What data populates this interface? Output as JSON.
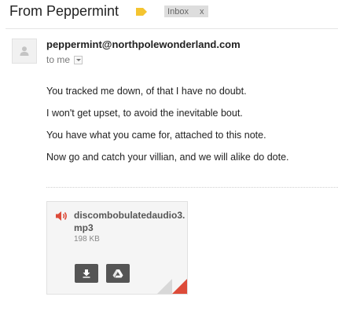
{
  "subject": "From Peppermint",
  "label_color": "#f4c430",
  "inbox_chip": {
    "label": "Inbox",
    "close": "x"
  },
  "message": {
    "sender_email": "peppermint@northpolewonderland.com",
    "recipient": "to me",
    "body_lines": [
      "You tracked me down, of that I have no doubt.",
      "I won't get upset, to avoid the inevitable bout.",
      "You have what you came for, attached to this note.",
      "Now go and catch your villian, and we will alike do dote."
    ]
  },
  "attachment": {
    "filename": "discombobulatedaudio3.mp3",
    "size": "198 KB",
    "icon": "audio-icon",
    "actions": [
      "download-icon",
      "google-drive-icon"
    ],
    "accent": "#dd4b39"
  }
}
